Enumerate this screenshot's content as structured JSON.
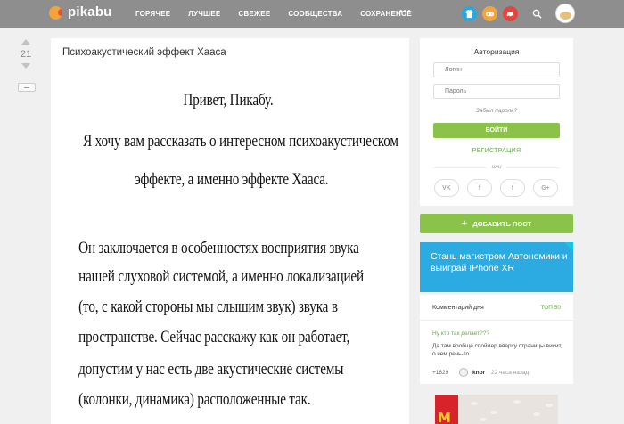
{
  "header": {
    "logo_text": "pikabu",
    "nav": [
      "ГОРЯЧЕЕ",
      "ЛУЧШЕЕ",
      "СВЕЖЕЕ",
      "СООБЩЕСТВА",
      "СОХРАНЕНОЕ"
    ],
    "more": "•••",
    "icons": [
      {
        "name": "tshirt-icon",
        "color": "#2aa7df"
      },
      {
        "name": "gamepad-icon",
        "color": "#f0a63a"
      },
      {
        "name": "car-icon",
        "color": "#e2463f"
      }
    ]
  },
  "story": {
    "rating": "21",
    "title": "Психоакустический эффект Хааса",
    "image_lines": [
      "Привет, Пикабу.",
      "Я хочу вам рассказать о интересном психоакустическом",
      "эффекте, а именно эффекте Хааса.",
      "Он заключается в особенностях восприятия звука",
      "нашей слуховой системой, а именно локализацией",
      "(то, с какой стороны мы слышим звук) звука в",
      "пространстве. Сейчас расскажу как он работает,",
      "допустим у нас есть две акустические системы",
      "(колонки, динамика) расположенные так."
    ]
  },
  "auth": {
    "title": "Авторизация",
    "login_placeholder": "Логин",
    "password_placeholder": "Пароль",
    "forgot": "Забыл пароль?",
    "login_button": "ВОЙТИ",
    "register": "РЕГИСТРАЦИЯ",
    "or": "или",
    "social": [
      "VK",
      "f",
      "t",
      "G+"
    ]
  },
  "add_post": "ДОБАВИТЬ ПОСТ",
  "banner": {
    "text": "Стань магистром Автономики и выиграй IPhone XR"
  },
  "comment_of_day": {
    "heading": "Комментарий дня",
    "top_link": "ТОП 50",
    "post_link": "Ну кто так делает???",
    "text": "Да там вообще спойлер вверху страницы висит, о чем речь-то",
    "rating": "+1629",
    "user": "knor",
    "time": "22 часа назад"
  },
  "ad": {
    "logo": "M"
  }
}
